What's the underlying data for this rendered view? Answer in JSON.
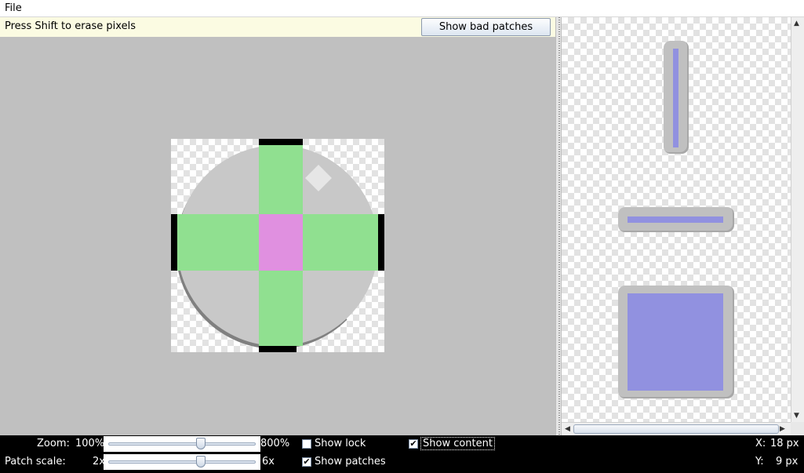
{
  "menubar": {
    "file_label": "File"
  },
  "editor": {
    "hint": "Press Shift to erase pixels",
    "bad_patches_button": "Show bad patches"
  },
  "colors": {
    "patch_green": "#90e090",
    "patch_pink": "#e090e0",
    "content_fill": "#9191e0",
    "marker_black": "#000000"
  },
  "statusbar": {
    "zoom_label": "Zoom:",
    "zoom_min": "100%",
    "zoom_max": "800%",
    "zoom_level": 0.63,
    "patch_scale_label": "Patch scale:",
    "patch_scale_min": "2x",
    "patch_scale_max": "6x",
    "patch_scale_level": 0.63,
    "show_lock": {
      "label": "Show lock",
      "checked": false
    },
    "show_content": {
      "label": "Show content",
      "checked": true
    },
    "show_patches": {
      "label": "Show patches",
      "checked": true
    },
    "x_label": "X:",
    "x_value": "18 px",
    "y_label": "Y:",
    "y_value": "9 px"
  }
}
